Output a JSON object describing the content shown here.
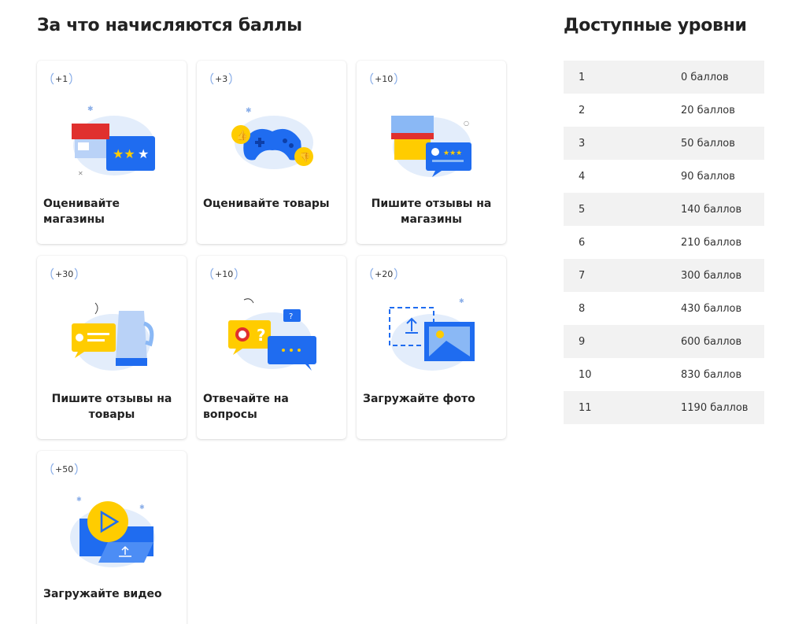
{
  "earn_section": {
    "title": "За что начисляются баллы",
    "cards": [
      {
        "points": "+1",
        "label": "Оценивайте магазины"
      },
      {
        "points": "+3",
        "label": "Оценивайте товары"
      },
      {
        "points": "+10",
        "label": "Пишите отзывы на магазины"
      },
      {
        "points": "+30",
        "label": "Пишите отзывы на товары"
      },
      {
        "points": "+10",
        "label": "Отвечайте на вопросы"
      },
      {
        "points": "+20",
        "label": "Загружайте фото"
      },
      {
        "points": "+50",
        "label": "Загружайте видео"
      }
    ]
  },
  "levels_section": {
    "title": "Доступные уровни",
    "levels": [
      {
        "level": "1",
        "points": "0 баллов"
      },
      {
        "level": "2",
        "points": "20 баллов"
      },
      {
        "level": "3",
        "points": "50 баллов"
      },
      {
        "level": "4",
        "points": "90 баллов"
      },
      {
        "level": "5",
        "points": "140 баллов"
      },
      {
        "level": "6",
        "points": "210 баллов"
      },
      {
        "level": "7",
        "points": "300 баллов"
      },
      {
        "level": "8",
        "points": "430 баллов"
      },
      {
        "level": "9",
        "points": "600 баллов"
      },
      {
        "level": "10",
        "points": "830 баллов"
      },
      {
        "level": "11",
        "points": "1190 баллов"
      }
    ]
  },
  "colors": {
    "blue": "#1f6cf0",
    "yellow": "#ffcc00",
    "red": "#e0302e",
    "light_blue": "#e3edfb",
    "row_shade": "#f2f2f2"
  }
}
